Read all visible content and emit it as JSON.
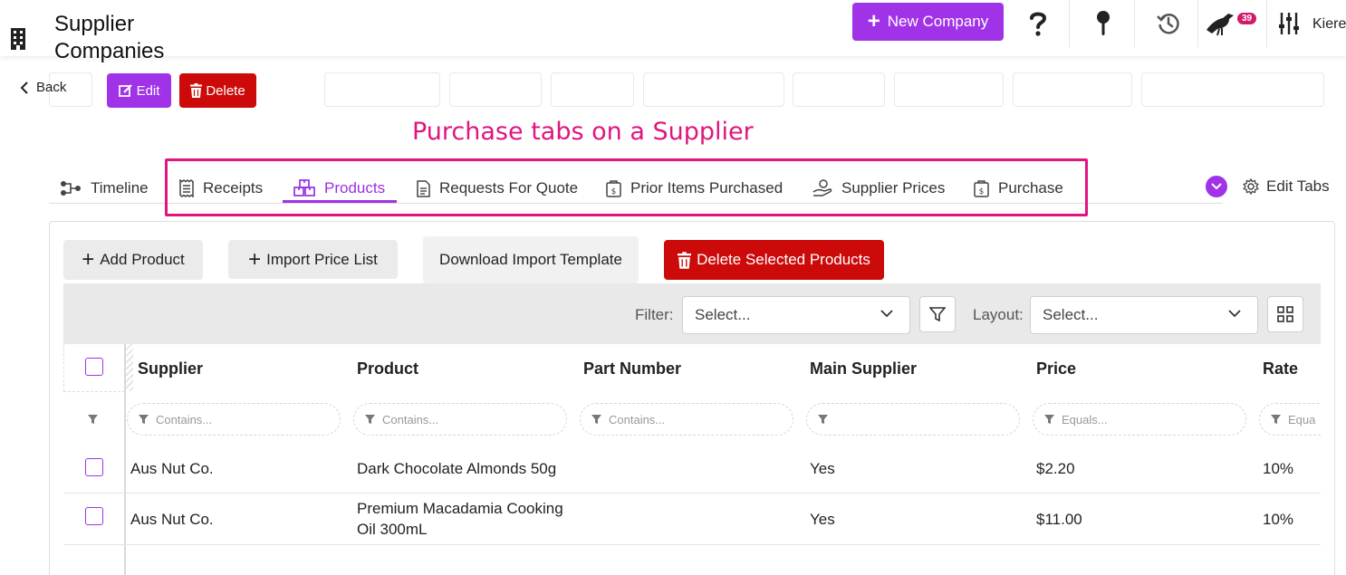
{
  "header": {
    "title": "Supplier Companies",
    "new_company_label": "New Company",
    "notification_count": "39",
    "user_name": "Kiere"
  },
  "actions": {
    "back_label": "Back",
    "edit_label": "Edit",
    "delete_label": "Delete"
  },
  "annotation": "Purchase tabs on a Supplier",
  "tabs": [
    {
      "label": "Timeline",
      "icon": "timeline-icon"
    },
    {
      "label": "Receipts",
      "icon": "receipt-icon"
    },
    {
      "label": "Products",
      "icon": "boxes-icon",
      "active": true
    },
    {
      "label": "Requests For Quote",
      "icon": "document-icon"
    },
    {
      "label": "Prior Items Purchased",
      "icon": "purchase-bag-icon"
    },
    {
      "label": "Supplier Prices",
      "icon": "hand-coin-icon"
    },
    {
      "label": "Purchase",
      "icon": "purchase-bag-icon"
    }
  ],
  "edit_tabs_label": "Edit Tabs",
  "panel": {
    "add_product_label": "Add Product",
    "import_price_list_label": "Import Price List",
    "download_template_label": "Download Import Template",
    "delete_selected_label": "Delete Selected Products"
  },
  "toolbar": {
    "filter_label": "Filter:",
    "filter_value": "Select...",
    "layout_label": "Layout:",
    "layout_value": "Select..."
  },
  "table": {
    "columns": [
      "Supplier",
      "Product",
      "Part Number",
      "Main Supplier",
      "Price",
      "Rate"
    ],
    "filters": [
      "Contains...",
      "Contains...",
      "Contains...",
      "",
      "Equals...",
      "Equa"
    ],
    "rows": [
      {
        "supplier": "Aus Nut Co.",
        "product": "Dark Chocolate Almonds 50g",
        "part_number": "",
        "main_supplier": "Yes",
        "price": "$2.20",
        "rate": "10%"
      },
      {
        "supplier": "Aus Nut Co.",
        "product_line1": "Premium Macadamia Cooking",
        "product_line2": "Oil 300mL",
        "part_number": "",
        "main_supplier": "Yes",
        "price": "$11.00",
        "rate": "10%"
      }
    ]
  },
  "colors": {
    "accent": "#a033e8",
    "danger": "#cc0a0a",
    "annotation": "#e0157f",
    "badge": "#d01b6b"
  }
}
